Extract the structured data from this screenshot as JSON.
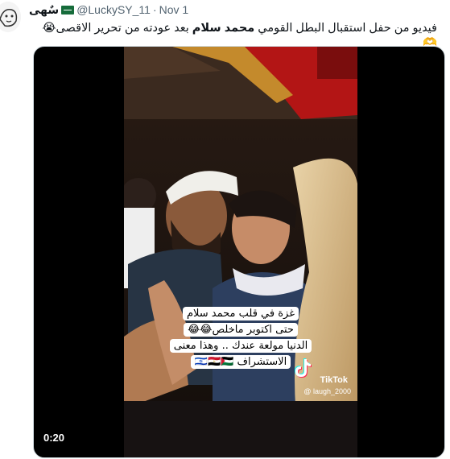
{
  "tweet": {
    "display_name": "سٌهى",
    "handle": "@LuckySY_11",
    "separator": "·",
    "date": "Nov 1",
    "text_before": "فيديو من حفل استقبال البطل القومي ",
    "text_bold": "محمد سلام",
    "text_after": " بعد عودته من تحرير الاقصى😭🫶"
  },
  "media": {
    "caption_lines": [
      "غزة في قلب محمد سلام",
      "حتى اكتوبر ماخلص😂😂",
      "الدنيا مولعة عندك .. وهذا معنى",
      "الاستشراف 🇮🇱🇪🇬🇵🇸"
    ],
    "tiktok_label": "TikTok",
    "tiktok_user": "@ laugh_2000",
    "timestamp": "0:20"
  },
  "colors": {
    "text": "#0f1419",
    "secondary_text": "#536471",
    "media_border": "#cfd9de",
    "stage_red": "#b31515",
    "flag_green": "#166c3b"
  },
  "icons": {
    "flag": "saudi-flag-icon",
    "tiktok": "tiktok-icon"
  }
}
